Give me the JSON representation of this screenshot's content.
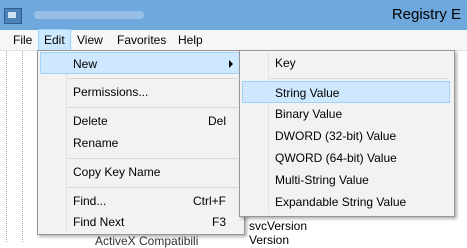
{
  "window": {
    "title": "Registry E",
    "icon": "registry-editor-icon"
  },
  "menubar": {
    "items": [
      {
        "label": "File"
      },
      {
        "label": "Edit"
      },
      {
        "label": "View"
      },
      {
        "label": "Favorites"
      },
      {
        "label": "Help"
      }
    ]
  },
  "background": {
    "tree_partial": "ActiveX Compatibili",
    "values": [
      "svcVersion",
      "Version"
    ]
  },
  "edit_menu": {
    "items": [
      {
        "label": "New",
        "shortcut": "",
        "has_submenu": true
      },
      {
        "label": "Permissions...",
        "shortcut": ""
      },
      {
        "label": "Delete",
        "shortcut": "Del"
      },
      {
        "label": "Rename",
        "shortcut": ""
      },
      {
        "label": "Copy Key Name",
        "shortcut": ""
      },
      {
        "label": "Find...",
        "shortcut": "Ctrl+F"
      },
      {
        "label": "Find Next",
        "shortcut": "F3"
      }
    ]
  },
  "new_submenu": {
    "items": [
      {
        "label": "Key"
      },
      {
        "label": "String Value"
      },
      {
        "label": "Binary Value"
      },
      {
        "label": "DWORD (32-bit) Value"
      },
      {
        "label": "QWORD (64-bit) Value"
      },
      {
        "label": "Multi-String Value"
      },
      {
        "label": "Expandable String Value"
      }
    ]
  },
  "colors": {
    "titlebar": "#6fa8dc",
    "menu_bg": "#f2f2f2",
    "highlight": "#cde8ff",
    "highlight_border": "#a0d1f9"
  }
}
